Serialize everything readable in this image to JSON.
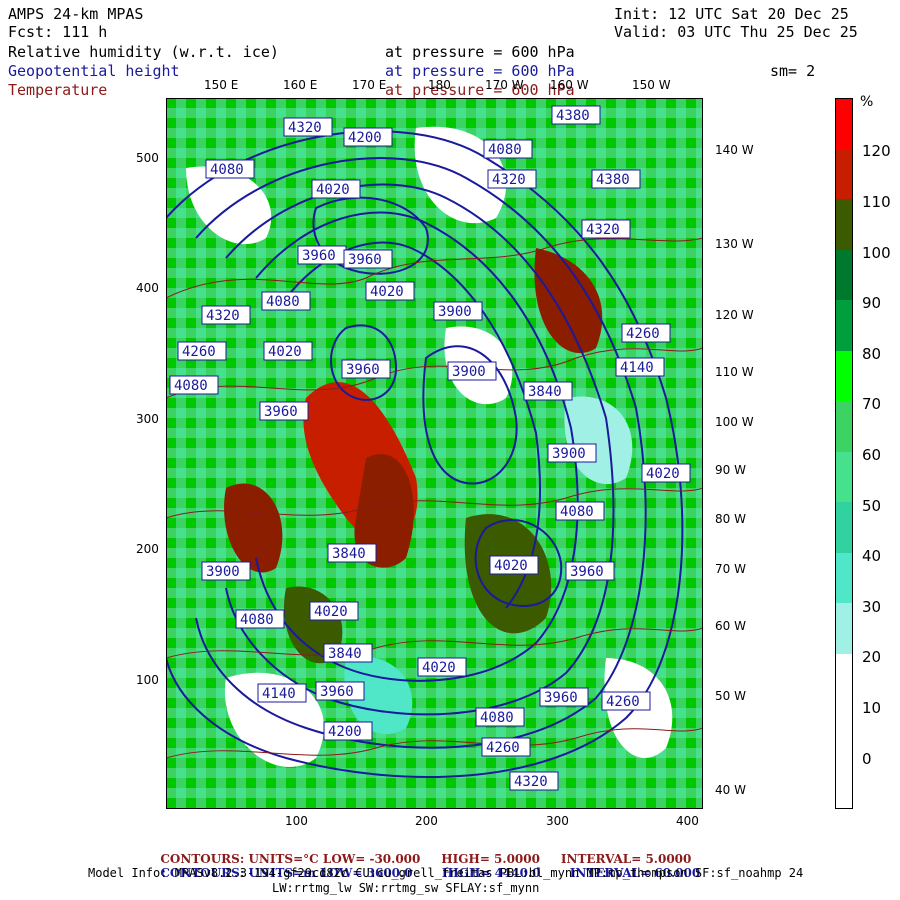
{
  "header": {
    "model": "AMPS 24-km MPAS",
    "fcst": "Fcst: 111 h",
    "init": "Init: 12 UTC Sat 20 Dec 25",
    "valid": "Valid: 03 UTC Thu 25 Dec 25"
  },
  "fields": [
    {
      "name": "Relative humidity (w.r.t. ice)",
      "level": "at pressure = 600 hPa",
      "color": "#000000"
    },
    {
      "name": "Geopotential height",
      "level": "at pressure = 600 hPa",
      "color": "#1a1a9c"
    },
    {
      "name": "Temperature",
      "level": "at pressure = 600 hPa",
      "color": "#8b1a1a"
    }
  ],
  "smoothing": "sm= 2",
  "axes": {
    "x_ticks": [
      "100",
      "200",
      "300",
      "400"
    ],
    "y_ticks": [
      "500",
      "400",
      "300",
      "200",
      "100"
    ],
    "top_lon_labels": [
      "150 E",
      "160 E",
      "170 E",
      "180",
      "170 W",
      "160 W",
      "150 W"
    ],
    "right_lon_labels": [
      "140 W",
      "130 W",
      "120 W",
      "110 W",
      "100 W",
      "90 W",
      "80 W",
      "70 W",
      "60 W",
      "50 W",
      "40 W"
    ]
  },
  "colorbar": {
    "unit": "%",
    "labels": [
      "120",
      "110",
      "100",
      "90",
      "80",
      "70",
      "60",
      "50",
      "40",
      "30",
      "20",
      "10",
      "0"
    ],
    "colors": [
      "#ff0000",
      "#c81e00",
      "#8c1e00",
      "#3c5a00",
      "#00782d",
      "#009e3c",
      "#00c800",
      "#00ff00",
      "#3cd264",
      "#46e18c",
      "#32d2a0",
      "#50e6c8",
      "#a0f0e6",
      "#ffffff",
      "#ffffff",
      "#ffffff",
      "#ffffff",
      "#ffffff",
      "#ffffff",
      "#ffffff",
      "#ffffff",
      "#ffffff",
      "#ffffff",
      "#ffffff",
      "#ffffff",
      "#ffffff"
    ]
  },
  "contour_labels_height": [
    "4320",
    "4200",
    "4380",
    "4080",
    "4020",
    "4080",
    "4320",
    "4380",
    "4320",
    "3960",
    "3960",
    "4020",
    "4320",
    "4080",
    "3900",
    "4260",
    "4260",
    "4020",
    "3960",
    "4140",
    "3900",
    "4080",
    "3840",
    "3960",
    "3900",
    "4020",
    "4080",
    "3840",
    "4020",
    "3900",
    "3960",
    "4020",
    "4080",
    "3840",
    "4020",
    "3960",
    "4140",
    "3960",
    "4080",
    "4260",
    "4200",
    "4260",
    "4320"
  ],
  "footer": {
    "line1": {
      "label": "CONTOURS:",
      "units": "UNITS=°C",
      "low": "LOW= -30.000",
      "high": "HIGH= 5.0000",
      "interval": "INTERVAL= 5.0000"
    },
    "line2": {
      "label": "CONTOURS:",
      "units": "UNITS=m",
      "low": "LOW= 3600.0",
      "high": "HIGH= 4440.0",
      "interval": "INTERVAL= 60.000"
    },
    "model_info_1": "Model Info: MPASv8.2.3-194-gf29cd82c CU:cu_grell_freitas PBL:bl_mynn MP:mp_thompson SF:sf_noahmp 24",
    "model_info_2": "LW:rrtmg_lw SW:rrtmg_sw SFLAY:sf_mynn"
  }
}
